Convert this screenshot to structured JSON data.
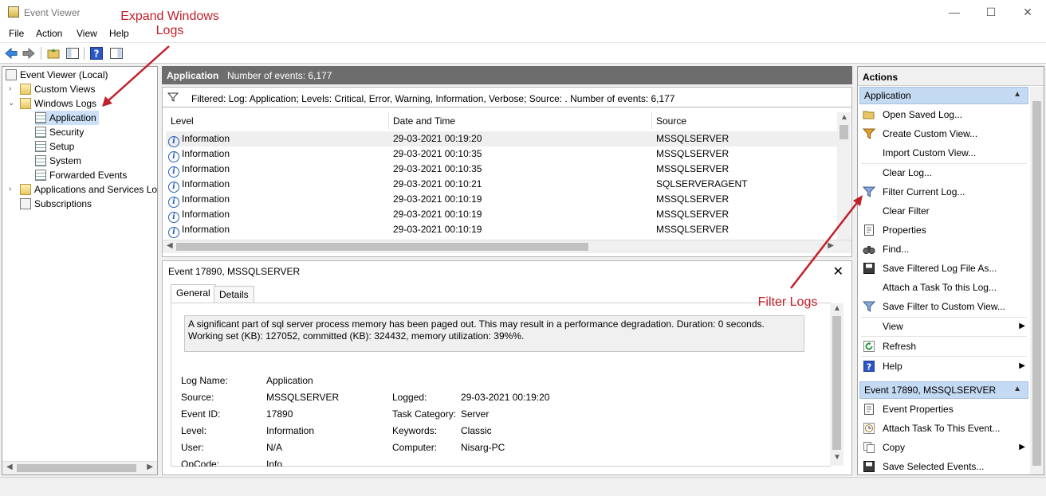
{
  "window": {
    "title": "Event Viewer",
    "minimize_glyph": "—",
    "maximize_glyph": "☐",
    "close_glyph": "✕"
  },
  "menu": [
    "File",
    "Action",
    "View",
    "Help"
  ],
  "tree": {
    "root": "Event Viewer (Local)",
    "custom_views": "Custom Views",
    "windows_logs": "Windows Logs",
    "application": "Application",
    "security": "Security",
    "setup": "Setup",
    "system": "System",
    "forwarded_events": "Forwarded Events",
    "apps_services": "Applications and Services Lo",
    "subscriptions": "Subscriptions"
  },
  "log_header": {
    "name": "Application",
    "count_text": "Number of events: 6,177"
  },
  "filter_text": "Filtered: Log: Application; Levels: Critical, Error, Warning, Information, Verbose; Source: . Number of events: 6,177",
  "columns": {
    "level": "Level",
    "date": "Date and Time",
    "source": "Source"
  },
  "events": [
    {
      "level": "Information",
      "date": "29-03-2021 00:19:20",
      "source": "MSSQLSERVER"
    },
    {
      "level": "Information",
      "date": "29-03-2021 00:10:35",
      "source": "MSSQLSERVER"
    },
    {
      "level": "Information",
      "date": "29-03-2021 00:10:35",
      "source": "MSSQLSERVER"
    },
    {
      "level": "Information",
      "date": "29-03-2021 00:10:21",
      "source": "SQLSERVERAGENT"
    },
    {
      "level": "Information",
      "date": "29-03-2021 00:10:19",
      "source": "MSSQLSERVER"
    },
    {
      "level": "Information",
      "date": "29-03-2021 00:10:19",
      "source": "MSSQLSERVER"
    },
    {
      "level": "Information",
      "date": "29-03-2021 00:10:19",
      "source": "MSSQLSERVER"
    }
  ],
  "detail": {
    "title": "Event 17890, MSSQLSERVER",
    "tabs": [
      "General",
      "Details"
    ],
    "description": "A significant part of sql server process memory has been paged out. This may result in a performance degradation. Duration: 0 seconds. Working set (KB): 127052, committed (KB): 324432, memory utilization: 39%%.",
    "fields": {
      "log_name_label": "Log Name:",
      "log_name": "Application",
      "source_label": "Source:",
      "source": "MSSQLSERVER",
      "logged_label": "Logged:",
      "logged": "29-03-2021 00:19:20",
      "event_id_label": "Event ID:",
      "event_id": "17890",
      "task_category_label": "Task Category:",
      "task_category": "Server",
      "level_label": "Level:",
      "level": "Information",
      "keywords_label": "Keywords:",
      "keywords": "Classic",
      "user_label": "User:",
      "user": "N/A",
      "computer_label": "Computer:",
      "computer": "Nisarg-PC",
      "opcode_label": "OpCode:",
      "opcode": "Info"
    }
  },
  "actions": {
    "header": "Actions",
    "section1": "Application",
    "items1": [
      "Open Saved Log...",
      "Create Custom View...",
      "Import Custom View...",
      "Clear Log...",
      "Filter Current Log...",
      "Clear Filter",
      "Properties",
      "Find...",
      "Save Filtered Log File As...",
      "Attach a Task To this Log...",
      "Save Filter to Custom View...",
      "View",
      "Refresh",
      "Help"
    ],
    "section2": "Event 17890, MSSQLSERVER",
    "items2": [
      "Event Properties",
      "Attach Task To This Event...",
      "Copy",
      "Save Selected Events..."
    ]
  },
  "annotations": {
    "expand": "Expand Windows Logs",
    "filter": "Filter Logs"
  },
  "colors": {
    "annotation": "#c0202a",
    "selection": "#cce0f7",
    "header_bar": "#6d6d6d",
    "section": "#c4d9f2"
  }
}
